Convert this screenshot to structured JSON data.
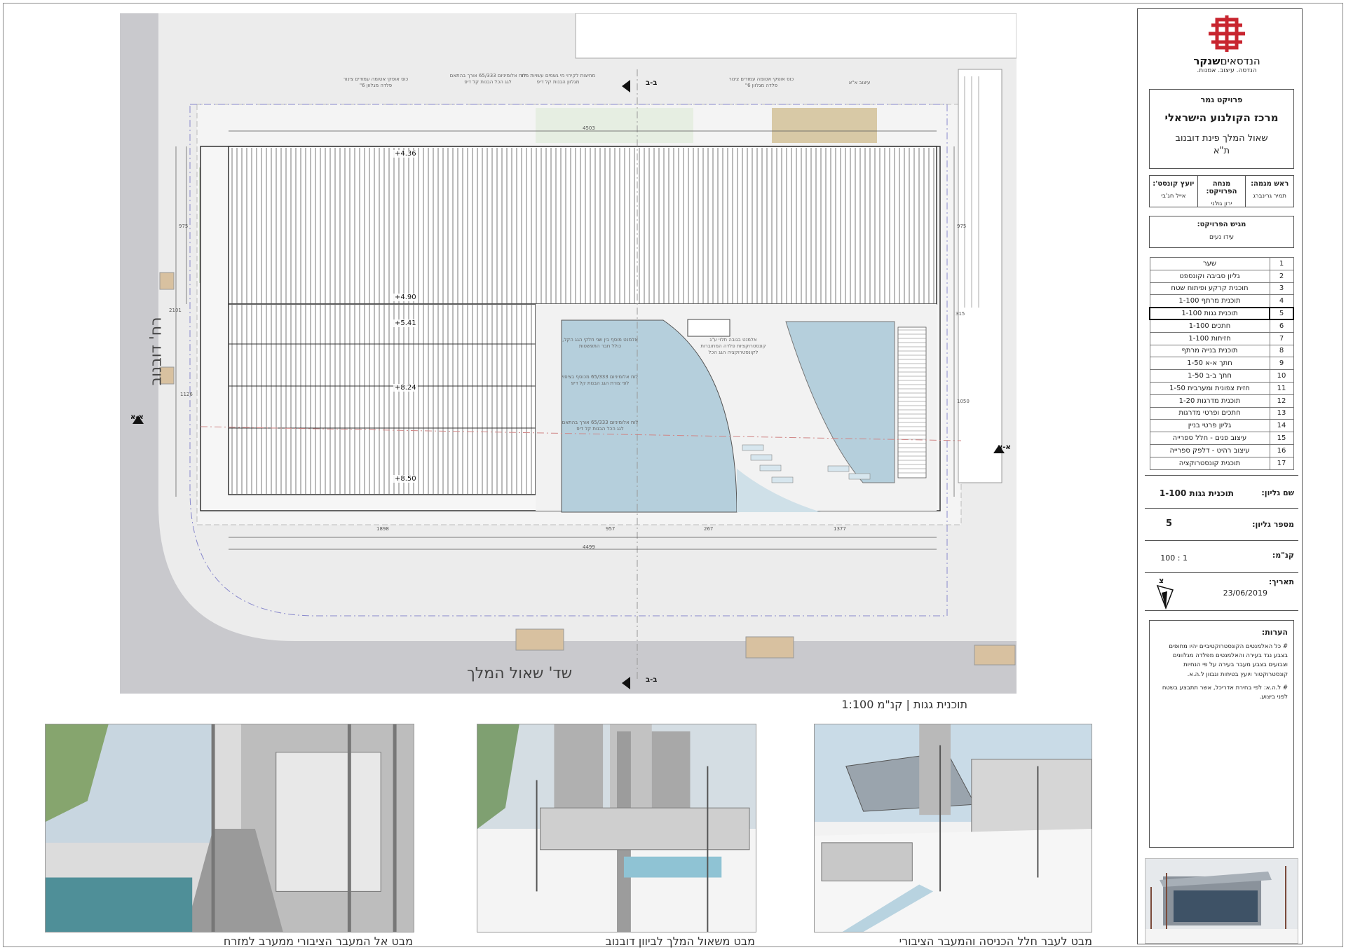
{
  "plan": {
    "street_west": "רח' דובנוב",
    "street_south": "שד' שאול המלך",
    "caption": "תוכנית גגות | קנ\"מ 1:100",
    "levels": [
      "+4.36",
      "+4.90",
      "+5.41",
      "+8.24",
      "+8.50"
    ],
    "section_marks": [
      "א-א",
      "א-א",
      "ב-ב",
      "ב-ב"
    ],
    "dimensions": [
      "4503",
      "4499",
      "1898",
      "957",
      "267",
      "1377",
      "975",
      "975",
      "2101",
      "1126",
      "1050",
      "315"
    ],
    "notes": [
      "כוס אופקי אטומה עמודים צינור פלדה מגלוון 6\"",
      "לוח אלומיניום 65/333 אורך בהתאם לגג הכל הבנות קל דיפ",
      "מחיצות לקירוי מי גשמים עשויות מחו מגלוון הבנות קל דיפ",
      "כוס אופקי אטומה עמודים צינור פלדה מגלוון 6\"",
      "עיצוב א\"א",
      "אלמנט בגובה תלוי ע\"ג קונסטרוקציות פלדה המחוברות לקונסטרוקציה הגג הכל",
      "אלמנט מוסף בין שני חלקי הגג הקל, כולל חבר התפשטות",
      "לוח אלומיניום 65/333 מכוסף בציפוי לפי צורת הגג הבנות קל דיפ",
      "לוח אלומיניום 65/333 אורך בהתאם לגג הכל הבנות קל דיפ"
    ]
  },
  "views": [
    {
      "caption": "מבט לעבר חלל הכניסה והמעבר הציבורי"
    },
    {
      "caption": "מבט משאול המלך לביוון דובנוב"
    },
    {
      "caption": "מבט אל המעבר הציבורי ממערב למזרח"
    }
  ],
  "title_block": {
    "logo_name_bold": "שנקר",
    "logo_name_rest": "הנדסאים",
    "logo_tagline": "הנדסה. עיצוב. אמנות.",
    "project_kind": "פרויקט גמר",
    "project_name": "מרכז הקולנוע הישראלי",
    "project_location_1": "שאול המלך פינת דובנוב",
    "project_location_2": "ת\"א",
    "roles": [
      {
        "title": "ראש מגמה:",
        "name": "תמיר גרינברג"
      },
      {
        "title": "מנחה הפרויקט:",
        "name": "ירון גולני"
      },
      {
        "title": "יועץ קונסט':",
        "name": "אייל חג'בי"
      }
    ],
    "presenter_title": "מגיש הפרויקט:",
    "presenter_name": "עידו נעים",
    "sheets": [
      {
        "num": "1",
        "name": "שער"
      },
      {
        "num": "2",
        "name": "גליון סביבה וקונספט"
      },
      {
        "num": "3",
        "name": "תוכנית קרקע ופיתוח שטח"
      },
      {
        "num": "4",
        "name": "תוכנית מרתף 1-100"
      },
      {
        "num": "5",
        "name": "תוכנית גגות 1-100"
      },
      {
        "num": "6",
        "name": "חתכים 1-100"
      },
      {
        "num": "7",
        "name": "חזיתות 1-100"
      },
      {
        "num": "8",
        "name": "תוכנית בנייה מרתף"
      },
      {
        "num": "9",
        "name": "חתך א-א 1-50"
      },
      {
        "num": "10",
        "name": "חתך ב-ב 1-50"
      },
      {
        "num": "11",
        "name": "חזית צפונית ומערבית 1-50"
      },
      {
        "num": "12",
        "name": "תוכנית מדרגות 1-20"
      },
      {
        "num": "13",
        "name": "חתכים ופרטי מדרגות"
      },
      {
        "num": "14",
        "name": "גליון פרטי בניין"
      },
      {
        "num": "15",
        "name": "עיצוב פנים - חלל ספרייה"
      },
      {
        "num": "16",
        "name": "עיצוב רהיט - דלפק ספרייה"
      },
      {
        "num": "17",
        "name": "תוכנית קונסטרוקציה"
      }
    ],
    "current_sheet_index": 4,
    "sheet_name_label": "שם גליון:",
    "sheet_name_value": "תוכנית גגות 1-100",
    "sheet_number_label": "מספר גליון:",
    "sheet_number_value": "5",
    "scale_label": "קנ\"מ:",
    "scale_value": "1 : 100",
    "date_label": "תאריך:",
    "date_value": "23/06/2019",
    "north_label": "צ",
    "notes_title": "הערות:",
    "notes": [
      "# כל האלמנטים הקונסטרוקטיביים יהיו מחופים בצבע נגד בעירה והאלמנטים מפלדה מגלוונים וצבועים בצבע מעבר בעירה על פי הנחיות קונסטרוקטור ויועץ בטיחות וגבוון ל.ה.א.",
      "# ל.ה.א: לפי בחירת אדריכל, אשר תתבצע בשטח לפני ביצוע."
    ]
  },
  "colors": {
    "road": "#c9c9cd",
    "sidewalk": "#ececec",
    "water": "#b5cfdc",
    "grass": "#c7d3bf",
    "sand": "#d8c9a6",
    "parking": "#d8c1a0",
    "logo_red": "#c8252f"
  }
}
